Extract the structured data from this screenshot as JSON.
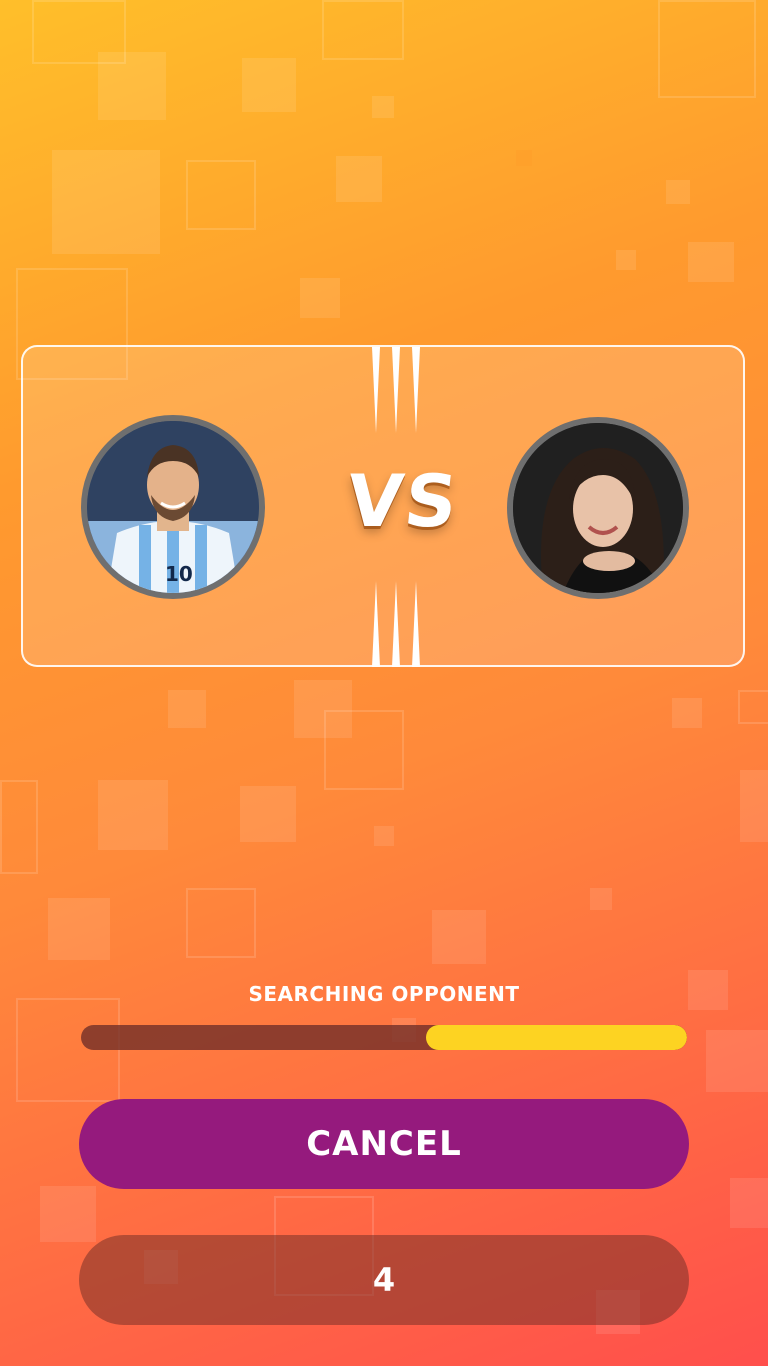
{
  "match": {
    "vs_label": "VS",
    "player_one": {
      "avatar": "player-one-avatar",
      "description": "footballer in blue and white striped shirt"
    },
    "player_two": {
      "avatar": "player-two-avatar",
      "description": "dark-haired woman smiling"
    }
  },
  "search": {
    "status_label": "SEARCHING OPPONENT",
    "progress_fraction": 0.43
  },
  "actions": {
    "cancel_label": "CANCEL"
  },
  "countdown": {
    "value": "4"
  },
  "colors": {
    "accent_yellow": "#fdd322",
    "cancel_purple": "#951a7d"
  }
}
